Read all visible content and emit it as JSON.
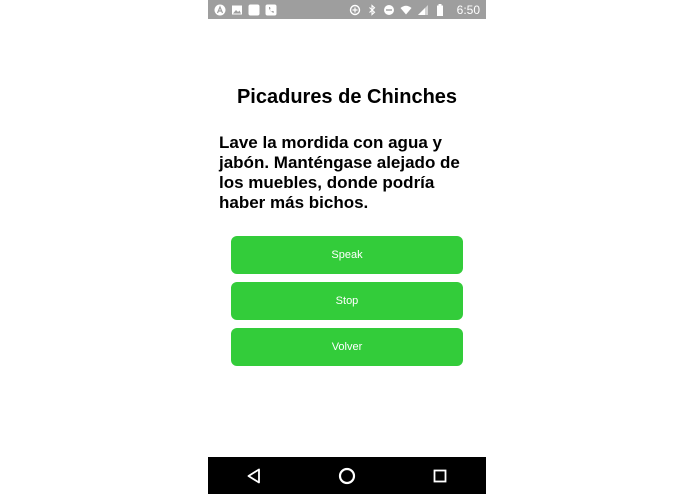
{
  "status_bar": {
    "time": "6:50",
    "left_icons": [
      "app-a-icon",
      "image-icon",
      "square-app-icon",
      "phone-app-icon"
    ],
    "right_icons": [
      "data-saver-icon",
      "bluetooth-icon",
      "do-not-disturb-icon",
      "wifi-icon",
      "signal-icon",
      "battery-icon"
    ]
  },
  "screen": {
    "title": "Picadures de Chinches",
    "body": "Lave la mordida con agua y jabón. Manténgase alejado de los muebles, donde podría haber más bichos.",
    "buttons": {
      "speak": "Speak",
      "stop": "Stop",
      "back": "Volver"
    },
    "button_color": "#33cc3a"
  },
  "nav_bar": {
    "icons": [
      "back-triangle-icon",
      "home-circle-icon",
      "recents-square-icon"
    ]
  }
}
